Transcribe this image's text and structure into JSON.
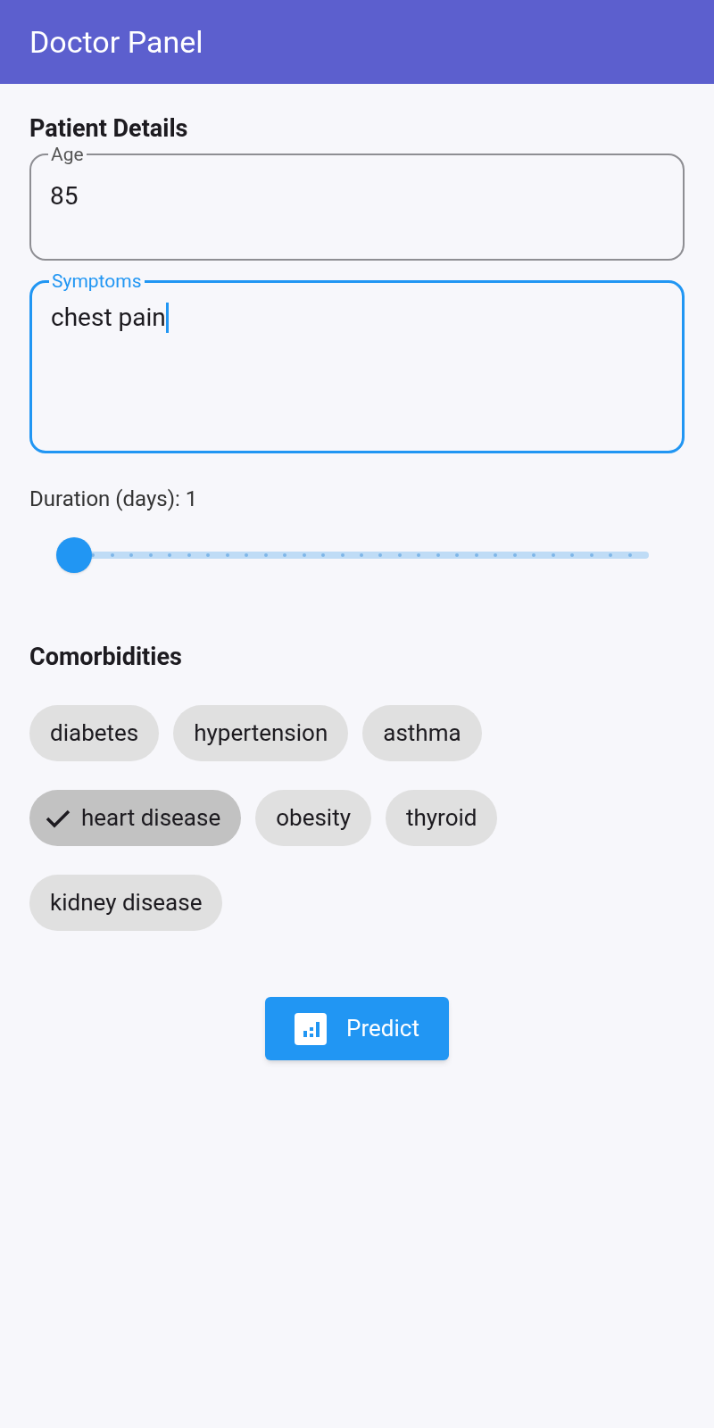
{
  "app_bar": {
    "title": "Doctor Panel"
  },
  "patient_details": {
    "heading": "Patient Details",
    "fields": [
      {
        "label": "Age",
        "value": "85",
        "focused": false,
        "multiline": false
      },
      {
        "label": "Symptoms",
        "value": "chest pain",
        "focused": true,
        "multiline": true
      }
    ]
  },
  "duration": {
    "label": "Duration (days): 1",
    "level": 0
  },
  "comorbidities": {
    "heading": "Comorbidities",
    "chips": [
      {
        "label": "diabetes",
        "selected": false
      },
      {
        "label": "hypertension",
        "selected": false
      },
      {
        "label": "asthma",
        "selected": false
      },
      {
        "label": "heart disease",
        "selected": true
      },
      {
        "label": "obesity",
        "selected": false
      },
      {
        "label": "thyroid",
        "selected": false
      },
      {
        "label": "kidney disease",
        "selected": false
      }
    ]
  },
  "predict_button": {
    "label": "Predict"
  }
}
